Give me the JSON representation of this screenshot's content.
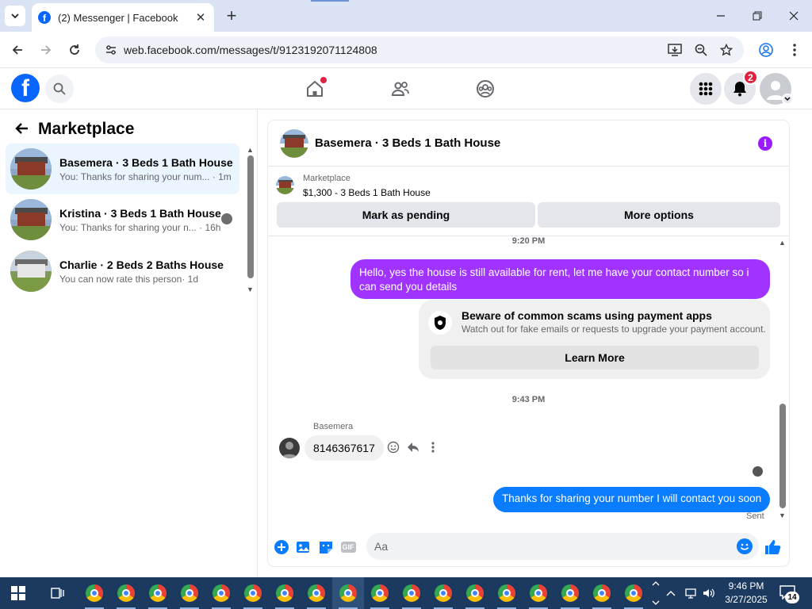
{
  "browser": {
    "tab_title": "(2) Messenger | Facebook",
    "tab_favicon": "f",
    "url": "web.facebook.com/messages/t/9123192071124808"
  },
  "fbnav": {
    "logo": "f",
    "notification_count": "2"
  },
  "sidebar": {
    "title": "Marketplace",
    "conversations": [
      {
        "name": "Basemera · 3 Beds 1 Bath House",
        "preview": "You: Thanks for sharing your num...",
        "time": "· 1m",
        "active": true
      },
      {
        "name": "Kristina · 3 Beds 1 Bath House",
        "preview": "You: Thanks for sharing your n...",
        "time": "· 16h",
        "active": false
      },
      {
        "name": "Charlie · 2 Beds 2 Baths House",
        "preview": "You can now rate this person",
        "time": "· 1d",
        "active": false
      }
    ]
  },
  "chat": {
    "title": "Basemera · 3 Beds 1 Bath House",
    "info_icon": "i",
    "listing": {
      "label": "Marketplace",
      "price_title": "$1,300 - 3 Beds 1 Bath House",
      "mark_pending": "Mark as pending",
      "more_options": "More options"
    },
    "time1": "9:20 PM",
    "msg_out_1": "Hello, yes the house is still available for rent, let me have your contact number so i can send you  details",
    "notice": {
      "title": "Beware of common scams using payment apps",
      "desc": "Watch out for fake emails or requests to upgrade your payment account.",
      "button": "Learn More"
    },
    "time2": "9:43 PM",
    "sender": "Basemera",
    "msg_in_1": "8146367617",
    "msg_out_2": "Thanks for sharing your number I will contact you soon",
    "status": "Sent",
    "composer_placeholder": "Aa",
    "gif_label": "GIF"
  },
  "taskbar": {
    "time": "9:46 PM",
    "date": "3/27/2025",
    "notif_count": "14"
  },
  "colors": {
    "fb_blue": "#0866ff",
    "outgoing_purple": "#a033ff",
    "outgoing_blue": "#0a7cff",
    "badge_red": "#e41e3f",
    "active_conv": "#ebf5ff"
  }
}
